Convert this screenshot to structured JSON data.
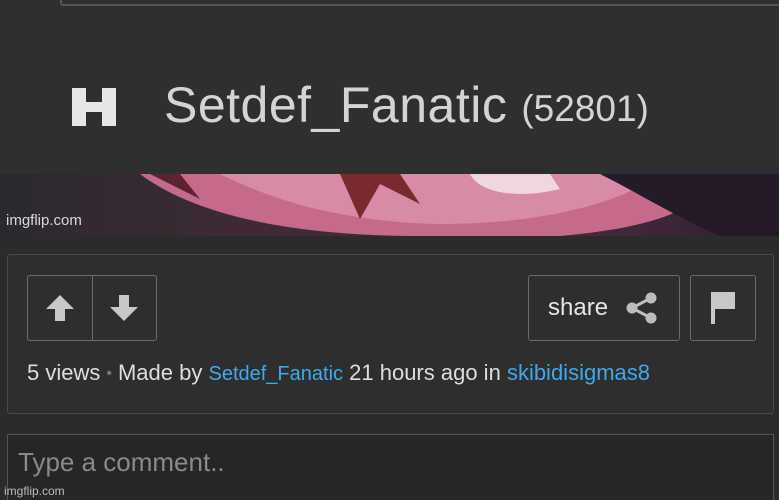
{
  "header": {
    "username": "Setdef_Fanatic",
    "points": "(52801)",
    "user_icon": "user-h-icon"
  },
  "meme": {
    "watermark": "imgflip.com"
  },
  "actions": {
    "upvote_icon": "arrow-up-icon",
    "downvote_icon": "arrow-down-icon",
    "share_label": "share",
    "share_icon": "share-icon",
    "flag_icon": "flag-icon"
  },
  "meta": {
    "views": "5 views",
    "made_by": "Made by",
    "author": "Setdef_Fanatic",
    "time": "21 hours ago in",
    "stream": "skibidisigmas8"
  },
  "comment": {
    "placeholder": "Type a comment.."
  },
  "footer": {
    "watermark": "imgflip.com"
  },
  "colors": {
    "background": "#2b2b2b",
    "link": "#3fa9ea",
    "text": "#dedede"
  }
}
